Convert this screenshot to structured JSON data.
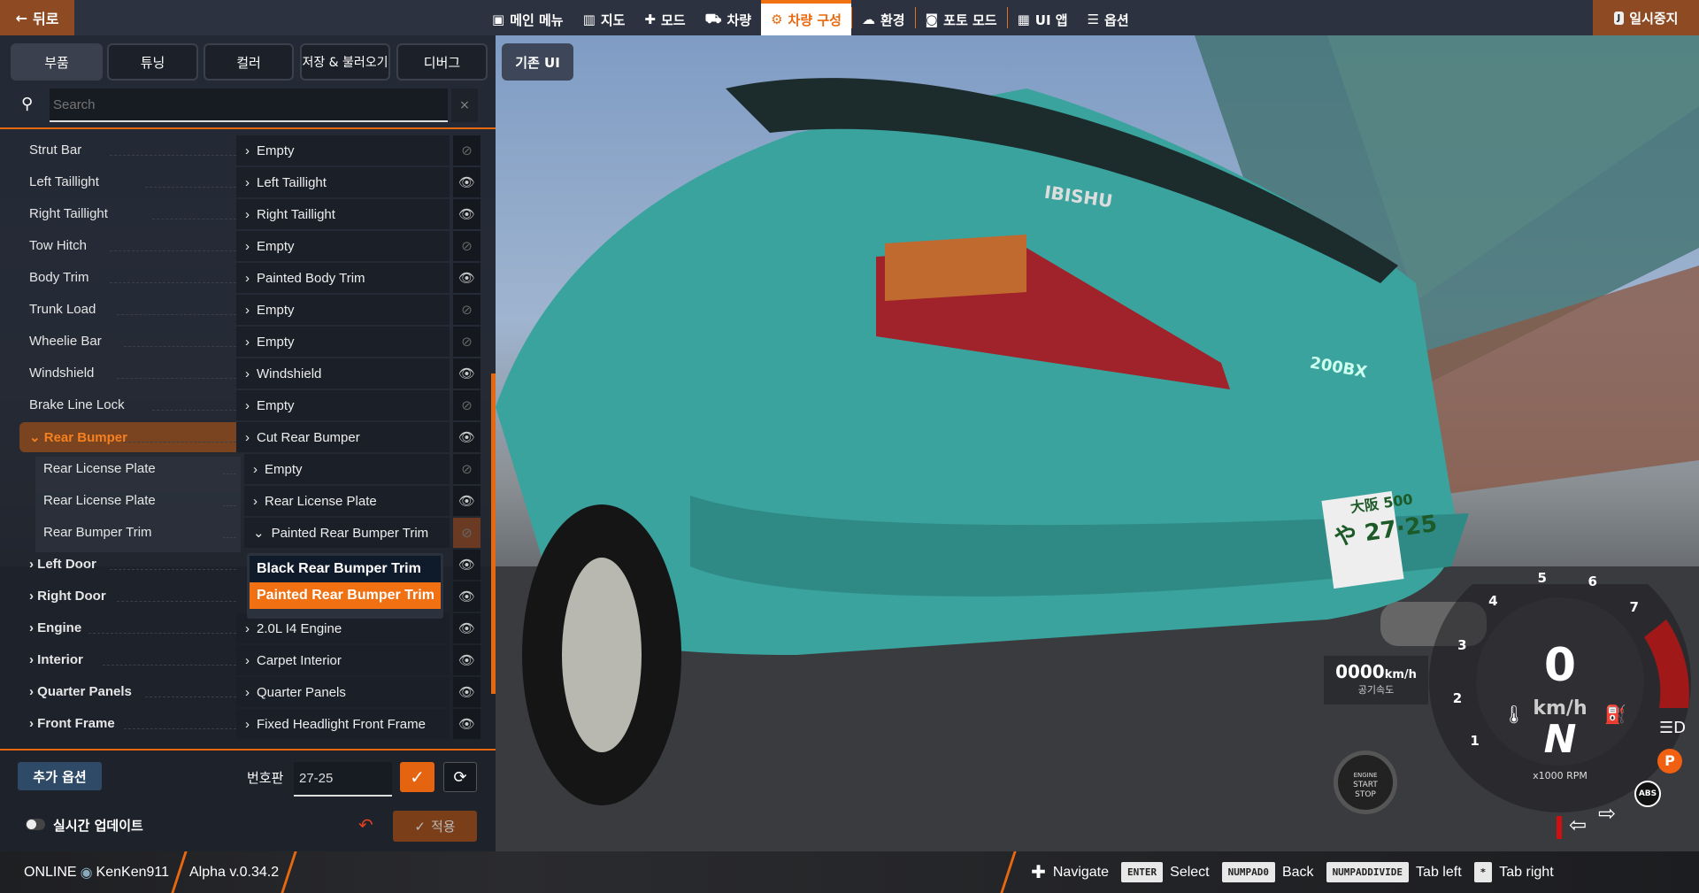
{
  "topbar": {
    "back_label": "뒤로",
    "nav": [
      {
        "label": "메인 메뉴",
        "icon": "main-menu-icon",
        "glyph": "▣"
      },
      {
        "label": "지도",
        "icon": "map-icon",
        "glyph": "▥"
      },
      {
        "label": "모드",
        "icon": "puzzle-icon",
        "glyph": "✚"
      },
      {
        "label": "차량",
        "icon": "car-icon",
        "glyph": "⛟"
      },
      {
        "label": "차량 구성",
        "icon": "engine-icon",
        "glyph": "⚙",
        "active": true
      },
      {
        "label": "환경",
        "icon": "weather-icon",
        "glyph": "☁"
      },
      {
        "label": "포토 모드",
        "icon": "camera-icon",
        "glyph": "◙"
      },
      {
        "label": "UI 앱",
        "icon": "ui-apps-icon",
        "glyph": "▦"
      },
      {
        "label": "옵션",
        "icon": "sliders-icon",
        "glyph": "☰"
      }
    ],
    "pause_key": "J",
    "pause_label": "일시중지"
  },
  "tabs": [
    "부품",
    "튜닝",
    "컬러",
    "저장 & 불러오기",
    "디버그"
  ],
  "legacy_ui_label": "기존 UI",
  "search": {
    "placeholder": "Search",
    "clear": "×"
  },
  "parts": [
    {
      "slot": "Strut Bar",
      "value": "Empty",
      "visible": false
    },
    {
      "slot": "Left Taillight",
      "value": "Left Taillight",
      "visible": true
    },
    {
      "slot": "Right Taillight",
      "value": "Right Taillight",
      "visible": true
    },
    {
      "slot": "Tow Hitch",
      "value": "Empty",
      "visible": false
    },
    {
      "slot": "Body Trim",
      "value": "Painted Body Trim",
      "visible": true
    },
    {
      "slot": "Trunk Load",
      "value": "Empty",
      "visible": false
    },
    {
      "slot": "Wheelie Bar",
      "value": "Empty",
      "visible": false
    },
    {
      "slot": "Windshield",
      "value": "Windshield",
      "visible": true
    },
    {
      "slot": "Brake Line Lock",
      "value": "Empty",
      "visible": false
    },
    {
      "slot": "Rear Bumper",
      "value": "Cut Rear Bumper",
      "visible": true,
      "expanded": true,
      "selected": true
    },
    {
      "slot": "Rear License Plate",
      "value": "Empty",
      "visible": false,
      "sub": true
    },
    {
      "slot": "Rear License Plate",
      "value": "Rear License Plate",
      "visible": true,
      "sub": true
    },
    {
      "slot": "Rear Bumper Trim",
      "value": "Painted Rear Bumper Trim",
      "visible": false,
      "sub": true,
      "open": true
    },
    {
      "slot": "Left Door",
      "value": "",
      "visible": true,
      "group": true
    },
    {
      "slot": "Right Door",
      "value": "",
      "visible": true,
      "group": true
    },
    {
      "slot": "Engine",
      "value": "2.0L I4 Engine",
      "visible": true,
      "group": true
    },
    {
      "slot": "Interior",
      "value": "Carpet Interior",
      "visible": true,
      "group": true
    },
    {
      "slot": "Quarter Panels",
      "value": "Quarter Panels",
      "visible": true,
      "group": true
    },
    {
      "slot": "Front Frame",
      "value": "Fixed Headlight Front Frame",
      "visible": true,
      "group": true
    }
  ],
  "dropdown": {
    "options": [
      "Black Rear Bumper Trim",
      "Painted Rear Bumper Trim"
    ],
    "selected": "Painted Rear Bumper Trim"
  },
  "footer": {
    "extra_options": "추가 옵션",
    "plate_label": "번호판",
    "plate_value": "27-25",
    "ok": "✓",
    "refresh": "⟳",
    "realtime_label": "실시간 업데이트",
    "realtime_on": false,
    "undo": "↶",
    "apply_label": "적용"
  },
  "hud": {
    "airspeed": "0000",
    "airspeed_unit": "km/h",
    "airspeed_label": "공기속도",
    "engine_btn": [
      "ENGINE",
      "START",
      "STOP"
    ],
    "speed": "0",
    "speed_unit": "km/h",
    "gear": "N",
    "rpm_label": "x1000 RPM",
    "rpm_ticks": [
      "1",
      "2",
      "3",
      "4",
      "5",
      "6",
      "7"
    ],
    "abs": "ABS",
    "parking": "P"
  },
  "car": {
    "badge": "IBISHU",
    "model": "200BX",
    "plate_top": "大阪 500",
    "plate_num": "や 27·25"
  },
  "status": {
    "online": "ONLINE",
    "user": "KenKen911",
    "version": "Alpha v.0.34.2",
    "hints": [
      {
        "key": "✚",
        "label": "Navigate",
        "plain": true
      },
      {
        "key": "ENTER",
        "label": "Select"
      },
      {
        "key": "NUMPAD0",
        "label": "Back"
      },
      {
        "key": "NUMPADDIVIDE",
        "label": "Tab left"
      },
      {
        "key": "*",
        "label": "Tab right"
      }
    ]
  },
  "colors": {
    "accent": "#f07012",
    "panel": "#1c202a",
    "car": "#3fa6a0"
  }
}
